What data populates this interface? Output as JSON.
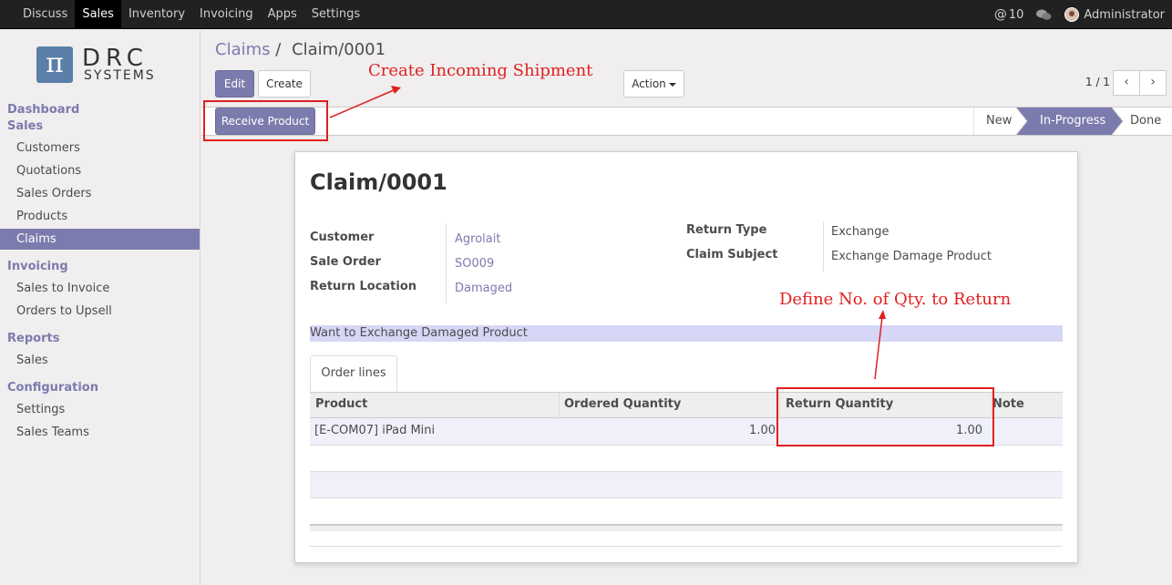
{
  "topbar": {
    "menu": [
      "Discuss",
      "Sales",
      "Inventory",
      "Invoicing",
      "Apps",
      "Settings"
    ],
    "active": "Sales",
    "messages_count": "10",
    "user": "Administrator"
  },
  "logo": {
    "symbol": "π",
    "line1": "DRC",
    "line2": "SYSTEMS"
  },
  "sidebar": {
    "dashboard": "Dashboard",
    "sales_section": "Sales",
    "sales_items": [
      "Customers",
      "Quotations",
      "Sales Orders",
      "Products",
      "Claims"
    ],
    "invoicing_section": "Invoicing",
    "invoicing_items": [
      "Sales to Invoice",
      "Orders to Upsell"
    ],
    "reports_section": "Reports",
    "reports_items": [
      "Sales"
    ],
    "configuration_section": "Configuration",
    "configuration_items": [
      "Settings",
      "Sales Teams"
    ]
  },
  "breadcrumb": {
    "parent": "Claims",
    "separator": "/",
    "current": "Claim/0001"
  },
  "buttons": {
    "edit": "Edit",
    "create": "Create",
    "action": "Action",
    "receive_product": "Receive Product"
  },
  "pager": {
    "text": "1 / 1",
    "prev": "‹",
    "next": "›"
  },
  "statusbar": {
    "stages": [
      "New",
      "In-Progress",
      "Done"
    ],
    "active": "In-Progress"
  },
  "form": {
    "title": "Claim/0001",
    "customer_label": "Customer",
    "customer": "Agrolait",
    "sale_order_label": "Sale Order",
    "sale_order": "SO009",
    "return_location_label": "Return Location",
    "return_location": "Damaged",
    "return_type_label": "Return Type",
    "return_type": "Exchange",
    "claim_subject_label": "Claim Subject",
    "claim_subject": "Exchange Damage Product",
    "description": "Want to Exchange Damaged Product",
    "tab": "Order lines",
    "columns": [
      "Product",
      "Ordered Quantity",
      "Return Quantity",
      "Note"
    ],
    "rows": [
      {
        "product": "[E-COM07] iPad Mini",
        "ordered_qty": "1.00",
        "return_qty": "1.00",
        "note": ""
      }
    ]
  },
  "annotations": {
    "create_shipment": "Create Incoming Shipment",
    "define_qty": "Define No. of Qty. to Return",
    "color": "#e02020"
  },
  "colors": {
    "accent": "#7c7bad",
    "topbar": "#212121"
  }
}
